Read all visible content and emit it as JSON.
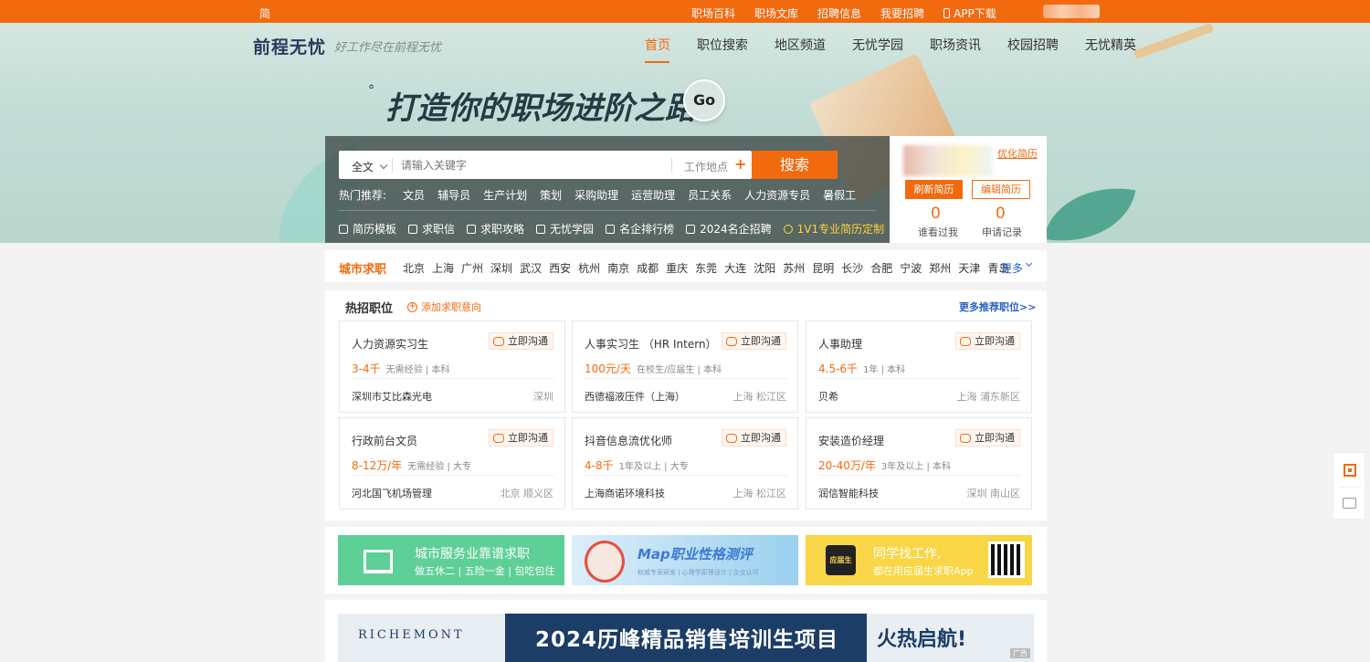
{
  "topbar": {
    "traditional": "简",
    "links": [
      "职场百科",
      "职场文库",
      "招聘信息",
      "我要招聘"
    ],
    "app_download": "APP下载"
  },
  "nav": {
    "logo": "前程无忧",
    "slogan": "好工作尽在前程无忧",
    "menu": [
      "首页",
      "职位搜索",
      "地区频道",
      "无忧学园",
      "职场资讯",
      "校园招聘",
      "无忧精英"
    ]
  },
  "hero": {
    "slogan": "打造你的职场进阶之路",
    "dot": "°",
    "go_label": "Go"
  },
  "search": {
    "type_label": "全文",
    "keyword_placeholder": "请输入关键字",
    "location_placeholder": "工作地点",
    "location_plus": "+",
    "button": "搜索",
    "hot_label": "热门推荐:",
    "hot_keywords": [
      "文员",
      "辅导员",
      "生产计划",
      "策划",
      "采购助理",
      "运营助理",
      "员工关系",
      "人力资源专员",
      "暑假工"
    ],
    "tools": [
      "简历模板",
      "求职信",
      "求职攻略",
      "无忧学园",
      "名企排行榜",
      "2024名企招聘"
    ],
    "highlight_tool": "1V1专业简历定制"
  },
  "profile": {
    "optimize": "优化简历",
    "refresh": "刷新简历",
    "edit": "编辑简历",
    "viewed_count": "0",
    "viewed_label": "谁看过我",
    "applied_count": "0",
    "applied_label": "申请记录"
  },
  "city": {
    "title": "城市求职",
    "cities": [
      "北京",
      "上海",
      "广州",
      "深圳",
      "武汉",
      "西安",
      "杭州",
      "南京",
      "成都",
      "重庆",
      "东莞",
      "大连",
      "沈阳",
      "苏州",
      "昆明",
      "长沙",
      "合肥",
      "宁波",
      "郑州",
      "天津",
      "青岛"
    ],
    "more": "更多"
  },
  "hotjobs": {
    "title": "热招职位",
    "add_intent": "添加求职意向",
    "more": "更多推荐职位>>",
    "chat_label": "立即沟通",
    "jobs": [
      {
        "title": "人力资源实习生",
        "salary": "3-4千",
        "req": "无需经验 | 本科",
        "company": "深圳市艾比森光电",
        "location": "深圳"
      },
      {
        "title": "人事实习生 （HR Intern）",
        "salary": "100元/天",
        "req": "在校生/应届生 | 本科",
        "company": "西德福液压件（上海）",
        "location": "上海 松江区"
      },
      {
        "title": "人事助理",
        "salary": "4.5-6千",
        "req": "1年 | 本科",
        "company": "贝希",
        "location": "上海 浦东新区"
      },
      {
        "title": "行政前台文员",
        "salary": "8-12万/年",
        "req": "无需经验 | 大专",
        "company": "河北国飞机场管理",
        "location": "北京 顺义区"
      },
      {
        "title": "抖音信息流优化师",
        "salary": "4-8千",
        "req": "1年及以上 | 大专",
        "company": "上海商诺环境科技",
        "location": "上海 松江区"
      },
      {
        "title": "安装造价经理",
        "salary": "20-40万/年",
        "req": "3年及以上 | 本科",
        "company": "润信智能科技",
        "location": "深圳 南山区"
      }
    ]
  },
  "banners": [
    {
      "title": "城市服务业靠谱求职",
      "subtitle": "做五休二 | 五险一金 | 包吃包住"
    },
    {
      "title": "Map职业性格测评",
      "subtitle": "权威专家研发 | 心理学原理设计 | 企业认可"
    },
    {
      "title": "同学找工作,",
      "subtitle": "都在用应届生求职App",
      "logo": "应届生"
    }
  ],
  "ad": {
    "brand": "RICHEMONT",
    "headline": "2024历峰精品销售培训生项目",
    "tagline": "火热启航!",
    "tag": "广告"
  },
  "colors": {
    "accent": "#f36a0e",
    "link": "#2b62c4"
  }
}
